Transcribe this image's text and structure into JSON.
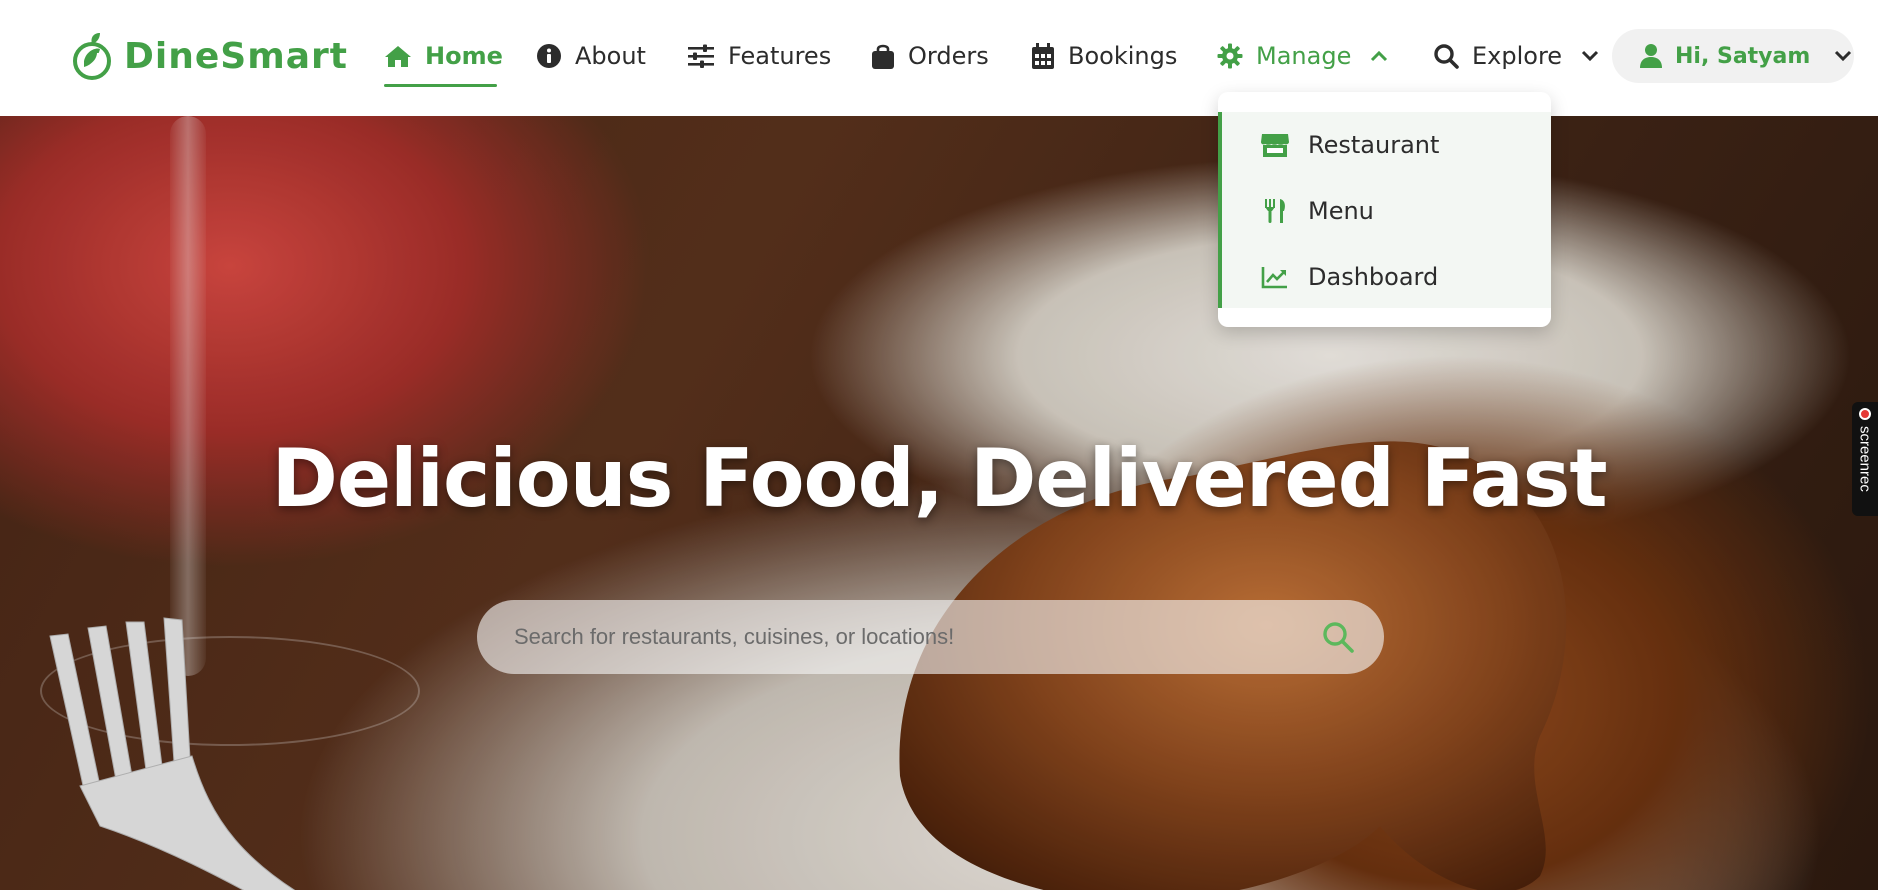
{
  "brand": {
    "name": "DineSmart",
    "color": "#43a047"
  },
  "nav": {
    "items": [
      {
        "label": "Home",
        "icon": "home-icon",
        "active": true
      },
      {
        "label": "About",
        "icon": "info-icon"
      },
      {
        "label": "Features",
        "icon": "sliders-icon"
      },
      {
        "label": "Orders",
        "icon": "shopping-bag-icon"
      },
      {
        "label": "Bookings",
        "icon": "calendar-icon"
      },
      {
        "label": "Manage",
        "icon": "gear-icon",
        "expanded": true
      },
      {
        "label": "Explore",
        "icon": "search-icon"
      }
    ],
    "user_greeting": "Hi, Satyam"
  },
  "manage_dropdown": {
    "items": [
      {
        "label": "Restaurant",
        "icon": "store-icon"
      },
      {
        "label": "Menu",
        "icon": "utensils-icon"
      },
      {
        "label": "Dashboard",
        "icon": "chart-line-icon"
      }
    ]
  },
  "hero": {
    "title": "Delicious Food, Delivered Fast",
    "search_placeholder": "Search for restaurants, cuisines, or locations!"
  },
  "screenrec": {
    "label": "screenrec"
  }
}
